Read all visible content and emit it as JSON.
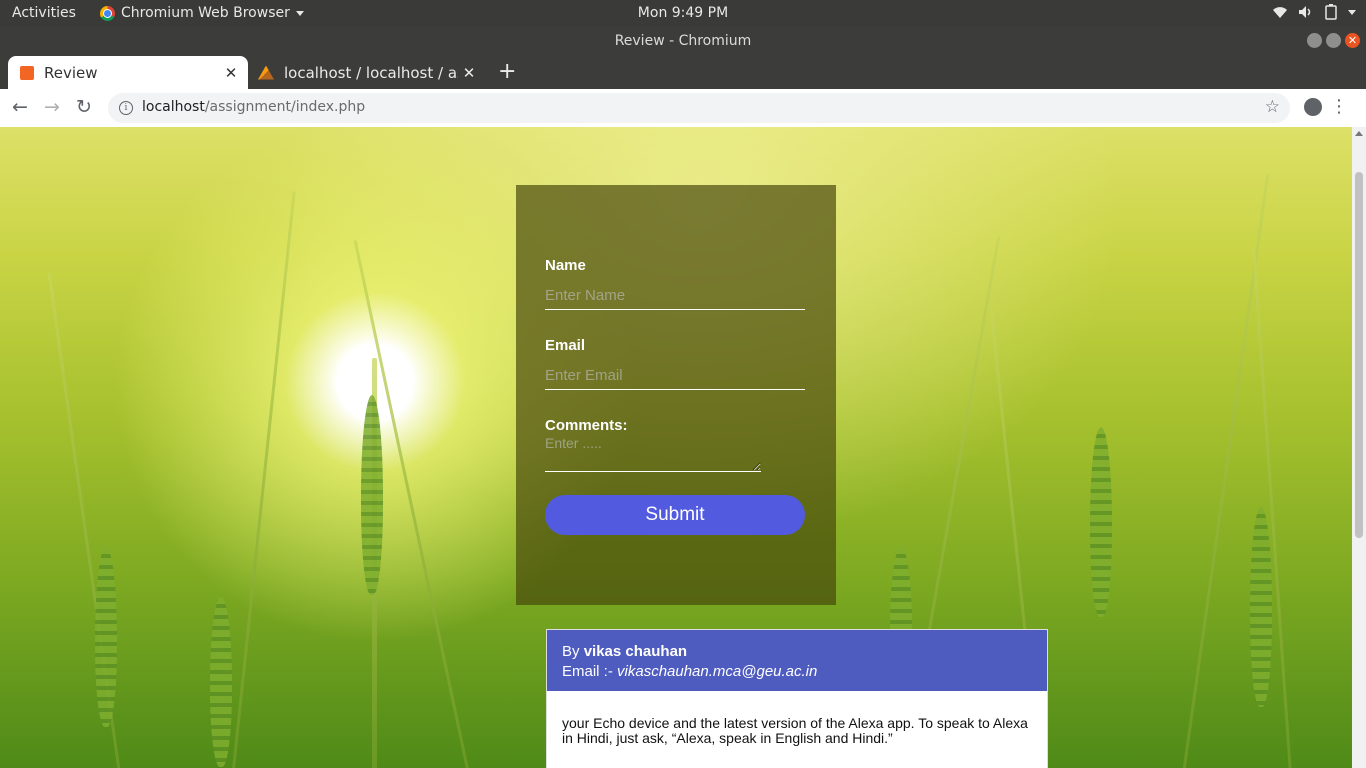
{
  "system_bar": {
    "activities": "Activities",
    "app_name": "Chromium Web Browser",
    "clock": "Mon  9:49 PM"
  },
  "window": {
    "title": "Review - Chromium"
  },
  "tabs": [
    {
      "label": "Review",
      "active": true
    },
    {
      "label": "localhost / localhost / assignment",
      "active": false
    }
  ],
  "toolbar": {
    "url_host": "localhost",
    "url_path": "/assignment/index.php"
  },
  "form": {
    "name_label": "Name",
    "name_placeholder": "Enter Name",
    "email_label": "Email",
    "email_placeholder": "Enter Email",
    "comments_label": "Comments:",
    "comments_placeholder": "Enter .....",
    "submit_label": "Submit"
  },
  "review": {
    "by_prefix": "By ",
    "author": "vikas chauhan",
    "email_prefix": "Email :- ",
    "email": "vikaschauhan.mca@geu.ac.in",
    "text": "your Echo device and the latest version of the Alexa app. To speak to Alexa in Hindi, just ask, “Alexa, speak in English and Hindi.”"
  },
  "colors": {
    "submit_button": "#525bdf",
    "card_header": "#4e5bbf",
    "form_panel": "rgba(70,70,10,0.68)"
  }
}
